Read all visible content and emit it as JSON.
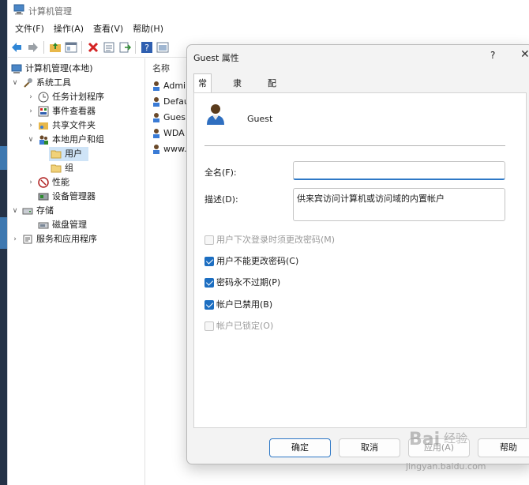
{
  "window": {
    "title": "计算机管理"
  },
  "menu": [
    "文件(F)",
    "操作(A)",
    "查看(V)",
    "帮助(H)"
  ],
  "toolbar_icons": [
    "back-icon",
    "forward-icon",
    "up-folder-icon",
    "show-hide-tree-icon",
    "delete-icon",
    "properties-icon",
    "export-icon",
    "help-icon",
    "console-icon"
  ],
  "tree": {
    "root": "计算机管理(本地)",
    "system_tools": "系统工具",
    "task_scheduler": "任务计划程序",
    "event_viewer": "事件查看器",
    "shared_folders": "共享文件夹",
    "local_users_groups": "本地用户和组",
    "users": "用户",
    "groups": "组",
    "performance": "性能",
    "device_manager": "设备管理器",
    "storage": "存储",
    "disk_management": "磁盘管理",
    "services_apps": "服务和应用程序"
  },
  "list": {
    "column_name": "名称",
    "items": [
      "Admi",
      "Defau",
      "Gues",
      "WDA",
      "www."
    ]
  },
  "dialog": {
    "title": "Guest 属性",
    "help": "?",
    "close": "✕",
    "tabs": [
      "常规",
      "隶属于",
      "配置文件"
    ],
    "user_name": "Guest",
    "full_name_label": "全名(F):",
    "full_name_value": "",
    "description_label": "描述(D):",
    "description_value": "供来宾访问计算机或访问域的内置帐户",
    "checkboxes": [
      {
        "label": "用户下次登录时须更改密码(M)",
        "checked": false,
        "disabled": true
      },
      {
        "label": "用户不能更改密码(C)",
        "checked": true,
        "disabled": false
      },
      {
        "label": "密码永不过期(P)",
        "checked": true,
        "disabled": false
      },
      {
        "label": "帐户已禁用(B)",
        "checked": true,
        "disabled": false
      },
      {
        "label": "帐户已锁定(O)",
        "checked": false,
        "disabled": true
      }
    ],
    "buttons": {
      "ok": "确定",
      "cancel": "取消",
      "apply": "应用(A)",
      "help": "帮助"
    }
  },
  "watermark": {
    "brand": "Bai",
    "suffix": "经验",
    "url": "jingyan.baidu.com"
  },
  "colors": {
    "accent": "#1c6ec1",
    "selection": "#cfe4f7",
    "default_button_border": "#2e78c6"
  }
}
